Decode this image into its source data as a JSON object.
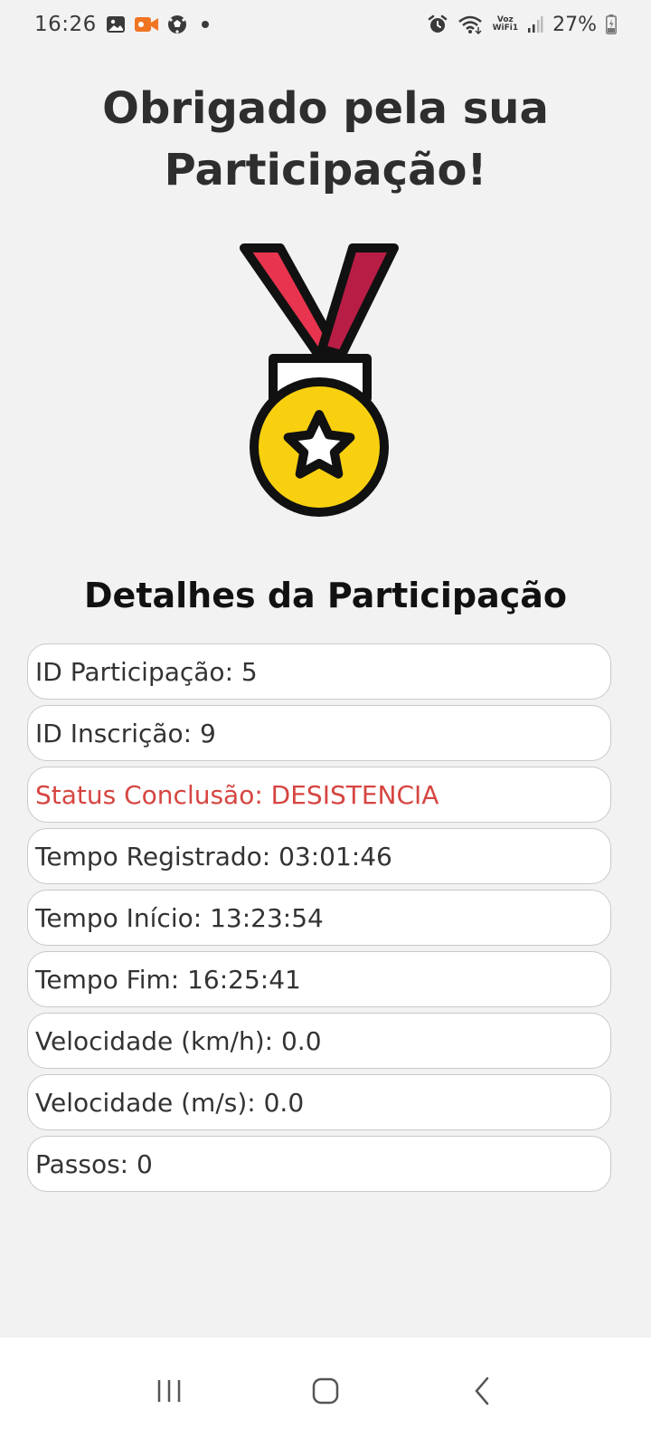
{
  "status_bar": {
    "time": "16:26",
    "battery": "27%",
    "notification_icons": [
      "gallery-icon",
      "video-icon",
      "soccer-ball-icon",
      "dot-icon"
    ],
    "system_icons": [
      "alarm-icon",
      "wifi-icon",
      "voz-wifi-icon",
      "signal-icon",
      "battery-icon"
    ],
    "voz_wifi_line1": "Voz",
    "voz_wifi_line2": "WiFi1"
  },
  "header": {
    "title": "Obrigado pela sua Participação!"
  },
  "medal": {
    "icon": "medal-icon",
    "ribbon_color": "#e8344e",
    "ribbon_dark_color": "#b81e45",
    "disc_color": "#f9d00f"
  },
  "details": {
    "title": "Detalhes da Participação",
    "rows": [
      {
        "text": "ID Participação: 5"
      },
      {
        "text": "ID Inscrição: 9"
      },
      {
        "text": "Status Conclusão: DESISTENCIA"
      },
      {
        "text": "Tempo Registrado: 03:01:46"
      },
      {
        "text": "Tempo Início: 13:23:54"
      },
      {
        "text": "Tempo Fim: 16:25:41"
      },
      {
        "text": "Velocidade (km/h): 0.0"
      },
      {
        "text": "Velocidade (m/s): 0.0"
      },
      {
        "text": "Passos: 0"
      }
    ],
    "status_color": "#d64541"
  },
  "nav_bar": {
    "buttons": [
      "recents-icon",
      "home-icon",
      "back-icon"
    ]
  }
}
